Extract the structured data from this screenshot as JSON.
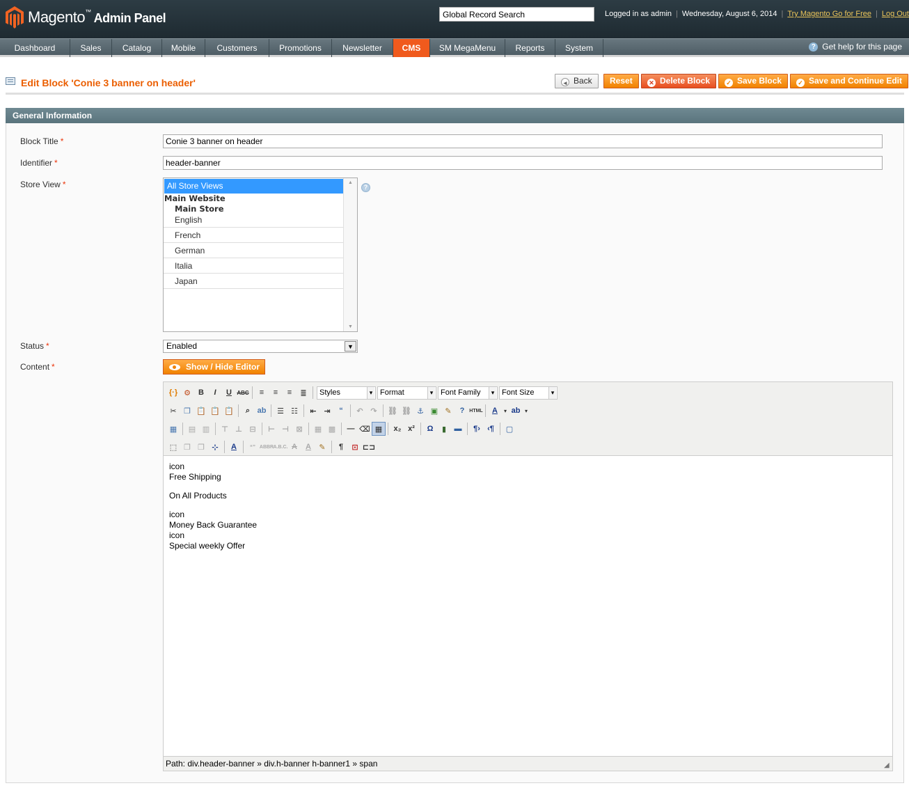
{
  "header": {
    "brand": "Magento",
    "brand_suffix": "Admin Panel",
    "search_value": "Global Record Search",
    "logged_in": "Logged in as admin",
    "date": "Wednesday, August 6, 2014",
    "try_link": "Try Magento Go for Free",
    "logout": "Log Out"
  },
  "nav": {
    "items": [
      "Dashboard",
      "Sales",
      "Catalog",
      "Mobile",
      "Customers",
      "Promotions",
      "Newsletter",
      "CMS",
      "SM MegaMenu",
      "Reports",
      "System"
    ],
    "active": "CMS",
    "help": "Get help for this page"
  },
  "page": {
    "title": "Edit Block 'Conie 3 banner on header'",
    "buttons": {
      "back": "Back",
      "reset": "Reset",
      "delete": "Delete Block",
      "save": "Save Block",
      "save_continue": "Save and Continue Edit"
    }
  },
  "section": {
    "title": "General Information"
  },
  "form": {
    "block_title_label": "Block Title",
    "block_title_value": "Conie 3 banner on header",
    "identifier_label": "Identifier",
    "identifier_value": "header-banner",
    "store_view_label": "Store View",
    "store_view": {
      "all": "All Store Views",
      "website": "Main Website",
      "store": "Main Store",
      "views": [
        "English",
        "French",
        "German",
        "Italia",
        "Japan"
      ],
      "selected": "All Store Views"
    },
    "status_label": "Status",
    "status_value": "Enabled",
    "content_label": "Content",
    "show_hide_editor": "Show / Hide Editor",
    "required_mark": "*"
  },
  "editor": {
    "selects": [
      "Styles",
      "Format",
      "Font Family",
      "Font Size"
    ],
    "content_lines": [
      "icon",
      "Free Shipping",
      "",
      "On All Products",
      "",
      "icon",
      "Money Back Guarantee",
      "icon",
      "Special weekly Offer"
    ],
    "path": "Path: div.header-banner » div.h-banner h-banner1 » span"
  },
  "colors": {
    "accent": "#eb5e00",
    "button": "#f18200",
    "nav_active": "#f05a1d",
    "selection": "#3399ff"
  }
}
